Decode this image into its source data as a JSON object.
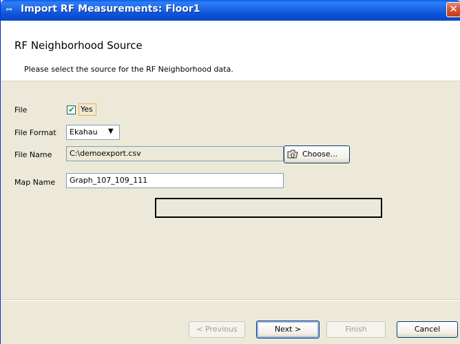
{
  "window": {
    "title": "Import RF Measurements: Floor1",
    "icon_symbol": "⚯",
    "close_symbol": "✕"
  },
  "header": {
    "title": "RF Neighborhood Source",
    "subtitle": "Please select the source for the RF Neighborhood data."
  },
  "form": {
    "file": {
      "label": "File",
      "checked": true,
      "check_symbol": "✔",
      "option_label": "Yes"
    },
    "file_format": {
      "label": "File Format",
      "selected": "Ekahau",
      "arrow_symbol": "▼"
    },
    "file_name": {
      "label": "File Name",
      "value": "C:\\demoexport.csv",
      "choose_button": "Choose..."
    },
    "map_name": {
      "label": "Map Name",
      "value": "Graph_107_109_111"
    }
  },
  "footer": {
    "previous": "< Previous",
    "next": "Next >",
    "finish": "Finish",
    "cancel": "Cancel"
  },
  "colors": {
    "titlebar": "#0a52d8",
    "panel": "#ece9d8",
    "close": "#d3532d",
    "check": "#21a121"
  }
}
